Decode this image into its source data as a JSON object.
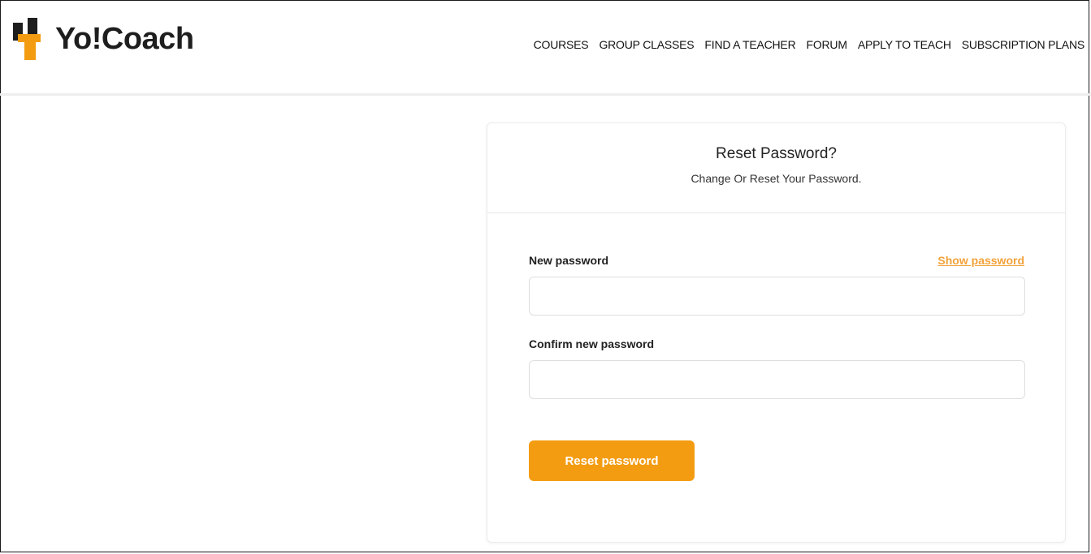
{
  "brand": {
    "name": "Yo!Coach",
    "accent_color": "#f39c12",
    "logo_icon": "yocoach-logo-icon"
  },
  "nav": {
    "items": [
      {
        "label": "COURSES"
      },
      {
        "label": "GROUP CLASSES"
      },
      {
        "label": "FIND A TEACHER"
      },
      {
        "label": "FORUM"
      },
      {
        "label": "APPLY TO TEACH"
      },
      {
        "label": "SUBSCRIPTION PLANS"
      }
    ]
  },
  "card": {
    "title": "Reset Password?",
    "subtitle": "Change Or Reset Your Password.",
    "new_password_label": "New password",
    "show_password_label": "Show password",
    "new_password_value": "",
    "confirm_password_label": "Confirm new password",
    "confirm_password_value": "",
    "submit_label": "Reset password"
  }
}
